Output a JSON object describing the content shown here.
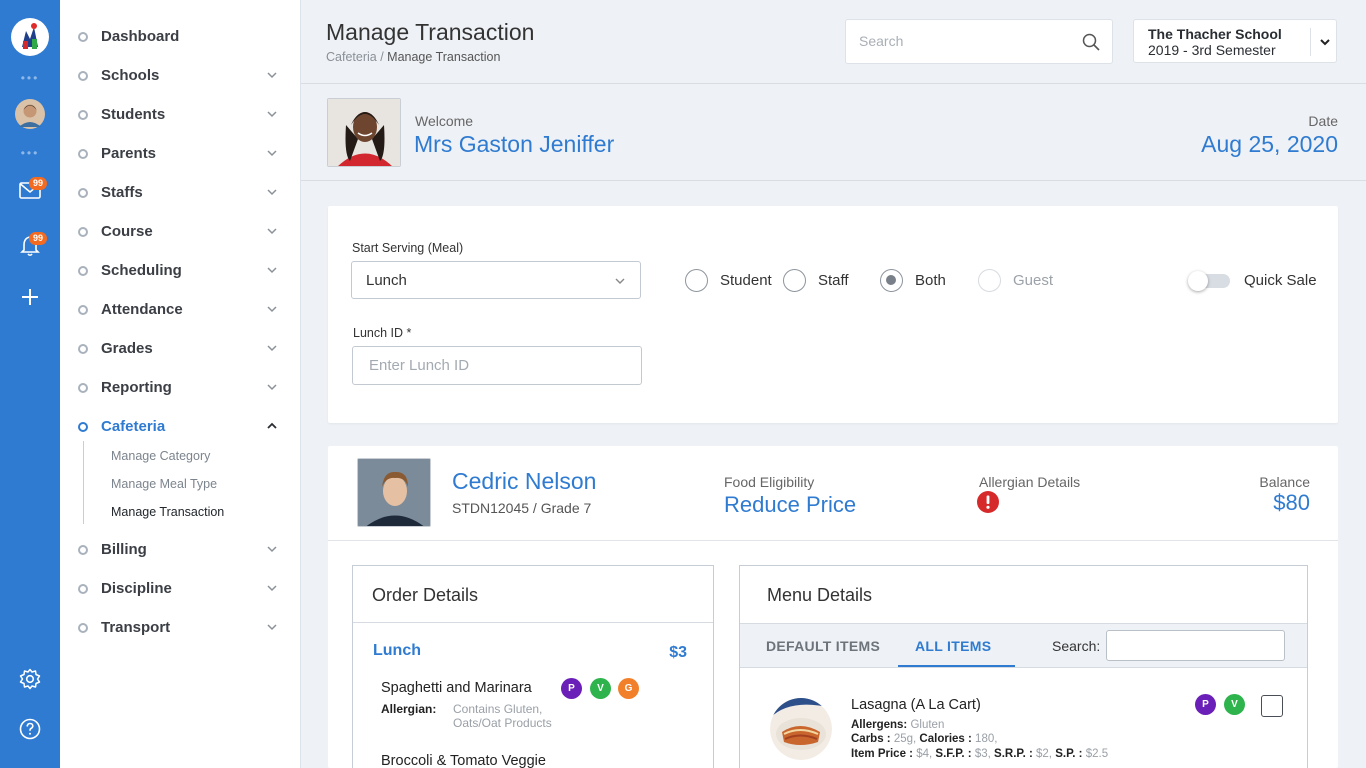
{
  "header": {
    "title": "Manage Transaction",
    "breadcrumb": {
      "parent": "Cafeteria /",
      "current": "Manage Transaction"
    },
    "search_placeholder": "Search",
    "school": {
      "name": "The Thacher School",
      "term": "2019 - 3rd Semester"
    }
  },
  "rail": {
    "mail_badge": "99",
    "notification_badge": "99",
    "icons": [
      "logo-icon",
      "user-avatar",
      "mail-icon",
      "bell-icon",
      "plus-icon",
      "settings-icon",
      "help-icon"
    ]
  },
  "sidebar": {
    "items": [
      {
        "label": "Dashboard"
      },
      {
        "label": "Schools"
      },
      {
        "label": "Students"
      },
      {
        "label": "Parents"
      },
      {
        "label": "Staffs"
      },
      {
        "label": "Course"
      },
      {
        "label": "Scheduling"
      },
      {
        "label": "Attendance"
      },
      {
        "label": "Grades"
      },
      {
        "label": "Reporting"
      },
      {
        "label": "Cafeteria"
      },
      {
        "label": "Billing"
      },
      {
        "label": "Discipline"
      },
      {
        "label": "Transport"
      }
    ],
    "cafeteria_sub": [
      "Manage Category",
      "Manage Meal Type",
      "Manage Transaction"
    ]
  },
  "welcome": {
    "label": "Welcome",
    "name": "Mrs Gaston Jeniffer",
    "date_label": "Date",
    "date": "Aug 25, 2020"
  },
  "serving": {
    "meal_label": "Start Serving (Meal)",
    "meal_value": "Lunch",
    "lunch_id_label": "Lunch ID *",
    "lunch_id_placeholder": "Enter Lunch ID",
    "radios": {
      "student": "Student",
      "staff": "Staff",
      "both": "Both",
      "guest": "Guest"
    },
    "selected": "Both",
    "quick_sale_label": "Quick Sale",
    "quick_sale_on": false
  },
  "student": {
    "name": "Cedric Nelson",
    "id_grade": "STDN12045 / Grade 7",
    "eligibility_label": "Food Eligibility",
    "eligibility": "Reduce Price",
    "allergen_label": "Allergian Details",
    "balance_label": "Balance",
    "balance": "$80"
  },
  "order": {
    "title": "Order Details",
    "meal": "Lunch",
    "price": "$3",
    "items": [
      {
        "name": "Spaghetti and Marinara",
        "allergen_label": "Allergian:",
        "allergen": "Contains Gluten,",
        "allergen2": "Oats/Oat Products",
        "chips": [
          "P",
          "V",
          "G"
        ]
      },
      {
        "name": "Broccoli & Tomato Veggie"
      }
    ]
  },
  "menu": {
    "title": "Menu Details",
    "tabs": [
      "DEFAULT ITEMS",
      "ALL ITEMS"
    ],
    "active_tab": "ALL ITEMS",
    "search_label": "Search:",
    "items": [
      {
        "name": "Lasagna (A La Cart)",
        "allergens_label": "Allergens:",
        "allergens": "Gluten",
        "carbs_label": "Carbs :",
        "carbs": "25g,",
        "calories_label": "Calories :",
        "calories": "180,",
        "price_label": "Item Price :",
        "price": "$4,",
        "sfp_label": "S.F.P. :",
        "sfp": "$3,",
        "srp_label": "S.R.P. :",
        "srp": "$2,",
        "sp_label": "S.P. :",
        "sp": "$2.5",
        "chips": [
          "P",
          "V"
        ]
      }
    ]
  },
  "colors": {
    "primary": "#2f7bd1",
    "badge": "#f36b21",
    "alert": "#d62a2a"
  }
}
